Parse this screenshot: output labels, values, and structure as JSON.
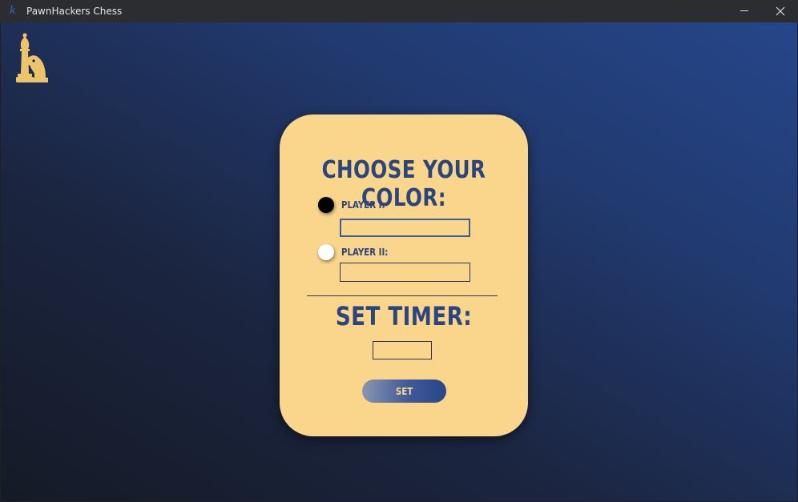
{
  "window": {
    "title": "PawnHackers Chess",
    "app_icon": "k-letter-icon",
    "minimize_icon": "minimize-icon",
    "close_icon": "close-icon"
  },
  "logo": {
    "icon": "bishop-knight-chess-icon",
    "color": "#ecc56a"
  },
  "card": {
    "color_heading": "Choose your color:",
    "players": [
      {
        "label": "Player I:",
        "color": "#000000",
        "value": "",
        "placeholder": ""
      },
      {
        "label": "Player II:",
        "color": "#ffffff",
        "value": "",
        "placeholder": ""
      }
    ],
    "timer_heading": "Set timer:",
    "timer_value": "",
    "set_label": "Set"
  },
  "colors": {
    "card_bg": "#f9d68b",
    "accent": "#2b467f",
    "title_bar": "#2b2d31"
  }
}
